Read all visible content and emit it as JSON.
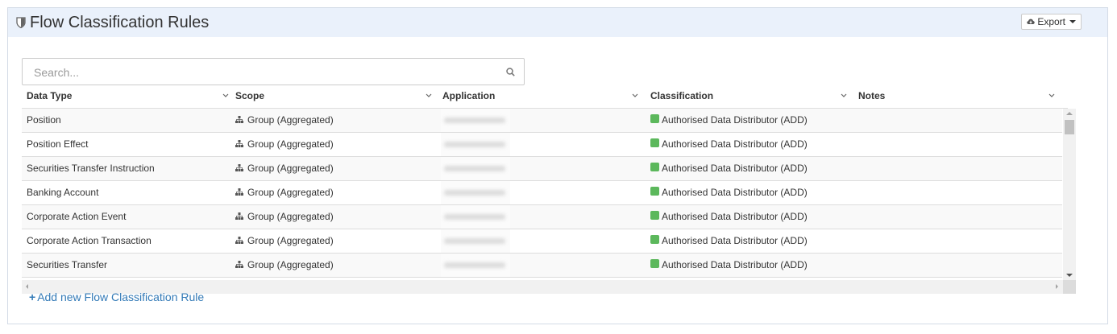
{
  "panel": {
    "title": "Flow Classification Rules",
    "export_label": "Export"
  },
  "search": {
    "placeholder": "Search..."
  },
  "table": {
    "columns": [
      "Data Type",
      "Scope",
      "Application",
      "Classification",
      "Notes"
    ],
    "rows": [
      {
        "data_type": "Position",
        "scope": "Group (Aggregated)",
        "classification": "Authorised Data Distributor (ADD)",
        "notes": ""
      },
      {
        "data_type": "Position Effect",
        "scope": "Group (Aggregated)",
        "classification": "Authorised Data Distributor (ADD)",
        "notes": ""
      },
      {
        "data_type": "Securities Transfer Instruction",
        "scope": "Group (Aggregated)",
        "classification": "Authorised Data Distributor (ADD)",
        "notes": ""
      },
      {
        "data_type": "Banking Account",
        "scope": "Group (Aggregated)",
        "classification": "Authorised Data Distributor (ADD)",
        "notes": ""
      },
      {
        "data_type": "Corporate Action Event",
        "scope": "Group (Aggregated)",
        "classification": "Authorised Data Distributor (ADD)",
        "notes": ""
      },
      {
        "data_type": "Corporate Action Transaction",
        "scope": "Group (Aggregated)",
        "classification": "Authorised Data Distributor (ADD)",
        "notes": ""
      },
      {
        "data_type": "Securities Transfer",
        "scope": "Group (Aggregated)",
        "classification": "Authorised Data Distributor (ADD)",
        "notes": ""
      }
    ]
  },
  "actions": {
    "add_rule_label": "Add new Flow Classification Rule"
  },
  "colors": {
    "classification_add": "#5cb85c",
    "link": "#337ab7",
    "header_bg": "#eaf1fb"
  },
  "icons": {
    "title": "shield-icon",
    "export": "cloud-download-icon",
    "search": "search-icon",
    "scope": "sitemap-icon",
    "column_menu": "chevron-down-icon",
    "add": "plus-icon"
  }
}
